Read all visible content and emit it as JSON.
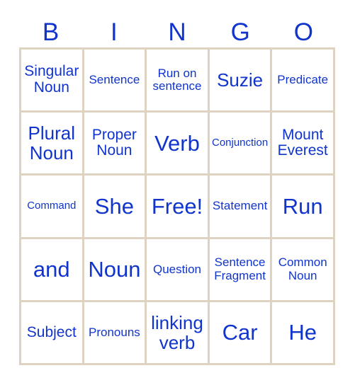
{
  "card": {
    "header": {
      "letters": [
        "B",
        "I",
        "N",
        "G",
        "O"
      ]
    },
    "colors": {
      "text_blue": "#1034CC",
      "grid_border": "#ded2c1",
      "background": "#ffffff"
    },
    "grid": {
      "rows": 5,
      "columns": 5,
      "cells": [
        {
          "text": "Singular Noun",
          "size": "l"
        },
        {
          "text": "Sentence",
          "size": "m"
        },
        {
          "text": "Run on sentence",
          "size": "m"
        },
        {
          "text": "Suzie",
          "size": "xl"
        },
        {
          "text": "Predicate",
          "size": "m"
        },
        {
          "text": "Plural Noun",
          "size": "xl"
        },
        {
          "text": "Proper Noun",
          "size": "l"
        },
        {
          "text": "Verb",
          "size": "xxl"
        },
        {
          "text": "Conjunction",
          "size": "s"
        },
        {
          "text": "Mount Everest",
          "size": "l"
        },
        {
          "text": "Command",
          "size": "s"
        },
        {
          "text": "She",
          "size": "xxl"
        },
        {
          "text": "Free!",
          "size": "xxl"
        },
        {
          "text": "Statement",
          "size": "m"
        },
        {
          "text": "Run",
          "size": "xxl"
        },
        {
          "text": "and",
          "size": "xxl"
        },
        {
          "text": "Noun",
          "size": "xxl"
        },
        {
          "text": "Question",
          "size": "m"
        },
        {
          "text": "Sentence Fragment",
          "size": "m"
        },
        {
          "text": "Common Noun",
          "size": "m"
        },
        {
          "text": "Subject",
          "size": "l"
        },
        {
          "text": "Pronouns",
          "size": "m"
        },
        {
          "text": "linking verb",
          "size": "xl"
        },
        {
          "text": "Car",
          "size": "xxl"
        },
        {
          "text": "He",
          "size": "xxl"
        }
      ]
    }
  }
}
